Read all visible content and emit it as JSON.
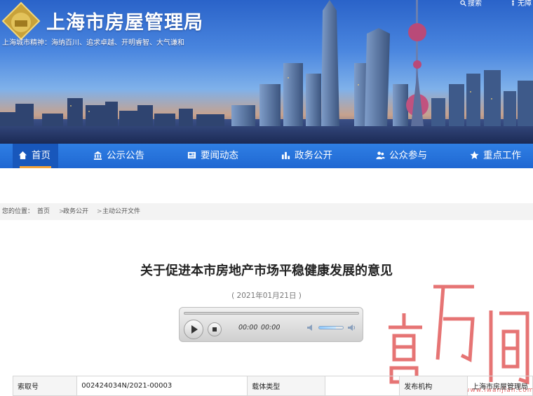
{
  "header": {
    "site_title": "上海市房屋管理局",
    "motto": "上海城市精神：海纳百川、追求卓越、开明睿智、大气谦和",
    "top_links": [
      {
        "label": "搜索",
        "icon": "search-icon"
      },
      {
        "label": "无障",
        "icon": "accessibility-icon"
      }
    ]
  },
  "nav": {
    "items": [
      {
        "label": "首页",
        "icon": "home-icon",
        "active": true
      },
      {
        "label": "公示公告",
        "icon": "bank-icon"
      },
      {
        "label": "要闻动态",
        "icon": "news-icon"
      },
      {
        "label": "政务公开",
        "icon": "bar-chart-icon"
      },
      {
        "label": "公众参与",
        "icon": "users-icon"
      },
      {
        "label": "重点工作",
        "icon": "star-icon"
      }
    ]
  },
  "breadcrumb": {
    "prefix": "您的位置：",
    "items": [
      "首页",
      "政务公开",
      "主动公开文件"
    ],
    "separator": ">"
  },
  "article": {
    "title": "关于促进本市房地产市场平稳健康发展的意见",
    "date": "( 2021年01月21日 )"
  },
  "player": {
    "current_time": "00:00",
    "duration": "00:00",
    "volume": 0.7
  },
  "watermark": {
    "url": "www.iwanjian.com"
  },
  "info_table": {
    "cells": [
      "索取号",
      "002424034N/2021-00003",
      "载体类型",
      "",
      "发布机构",
      "上海市房屋管理局"
    ]
  },
  "colors": {
    "nav_bg": "#2272d9",
    "nav_active": "#1857bb",
    "nav_active_underline": "#f2a33a",
    "watermark": "#e25c5c"
  }
}
